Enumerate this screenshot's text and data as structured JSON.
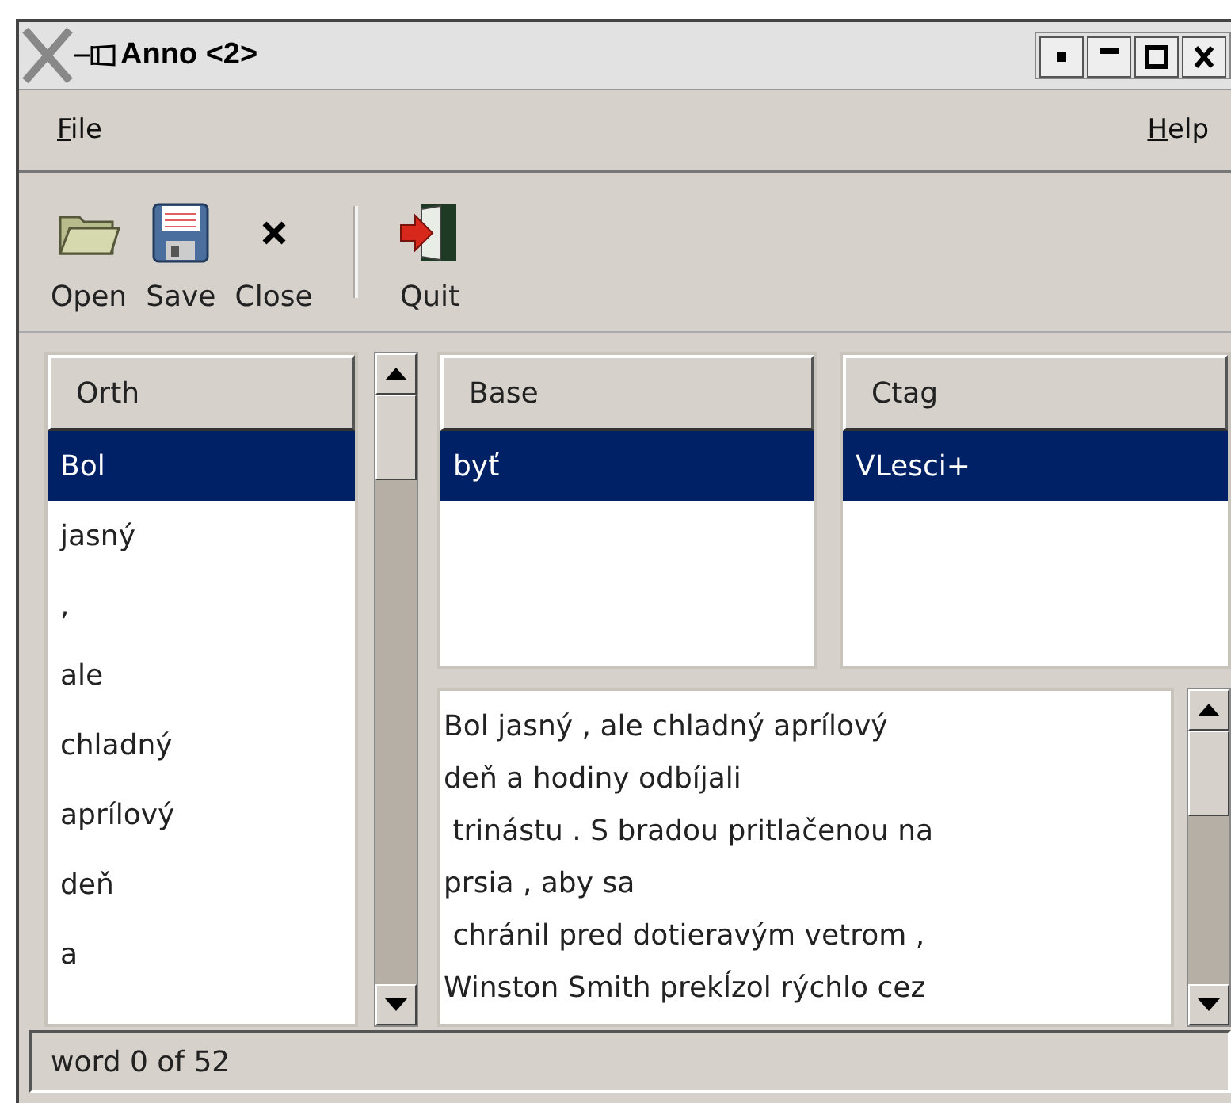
{
  "window": {
    "title": "Anno <2>"
  },
  "menu": [
    {
      "label": "File"
    },
    {
      "label": "Help"
    }
  ],
  "toolbar": [
    {
      "kind": "button",
      "label": "Open"
    },
    {
      "kind": "button",
      "label": "Save"
    },
    {
      "kind": "button",
      "label": "Close"
    },
    {
      "kind": "separator"
    },
    {
      "kind": "button",
      "label": "Quit"
    }
  ],
  "orth": {
    "heading": "Orth",
    "rows": [
      {
        "text": "Bol",
        "selected": true
      },
      {
        "text": "jasný",
        "selected": false
      },
      {
        "text": ",",
        "selected": false
      },
      {
        "text": "ale",
        "selected": false
      },
      {
        "text": "chladný",
        "selected": false
      },
      {
        "text": "aprílový",
        "selected": false
      },
      {
        "text": "deň",
        "selected": false
      },
      {
        "text": "a",
        "selected": false
      }
    ]
  },
  "base": {
    "heading": "Base",
    "rows": [
      {
        "text": "byť",
        "selected": true
      }
    ]
  },
  "ctag": {
    "heading": "Ctag",
    "rows": [
      {
        "text": "VLesci+",
        "selected": true
      }
    ]
  },
  "text_view": {
    "lines": [
      "Bol jasný , ale chladný aprílový",
      "deň a hodiny odbíjali",
      " trinástu . S bradou pritlačenou na",
      "prsia , aby sa",
      " chránil pred dotieravým vetrom ,",
      "Winston Smith prekĺzol rýchlo cez"
    ]
  },
  "status_bar": {
    "text": "word 0 of 52"
  }
}
